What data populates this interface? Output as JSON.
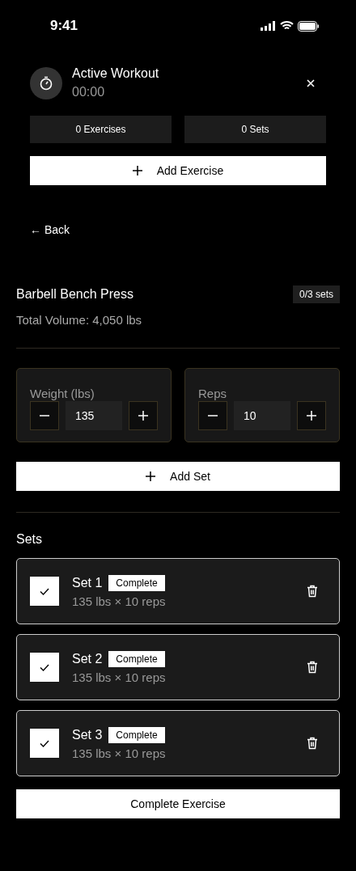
{
  "status_bar": {
    "time": "9:41"
  },
  "workout": {
    "title": "Active Workout",
    "timer": "00:00",
    "stats": [
      "0 Exercises",
      "0 Sets"
    ],
    "add_button": "Add Exercise"
  },
  "back": "← Back",
  "exercise": {
    "name": "Barbell Bench Press",
    "progress": "0/3 sets",
    "total_volume": "Total Volume: 4,050 lbs",
    "inputs": [
      {
        "label": "Weight (lbs)",
        "value": "135"
      },
      {
        "label": "Reps",
        "value": "10"
      }
    ],
    "add_set": "Add Set"
  },
  "sets_heading": "Sets",
  "sets": [
    {
      "name": "Set 1",
      "badge": "Complete",
      "detail": "135 lbs × 10 reps",
      "checked": true
    },
    {
      "name": "Set 2",
      "badge": "Complete",
      "detail": "135 lbs × 10 reps",
      "checked": true
    },
    {
      "name": "Set 3",
      "badge": "Complete",
      "detail": "135 lbs × 10 reps",
      "checked": true
    }
  ],
  "complete_button": "Complete Exercise"
}
